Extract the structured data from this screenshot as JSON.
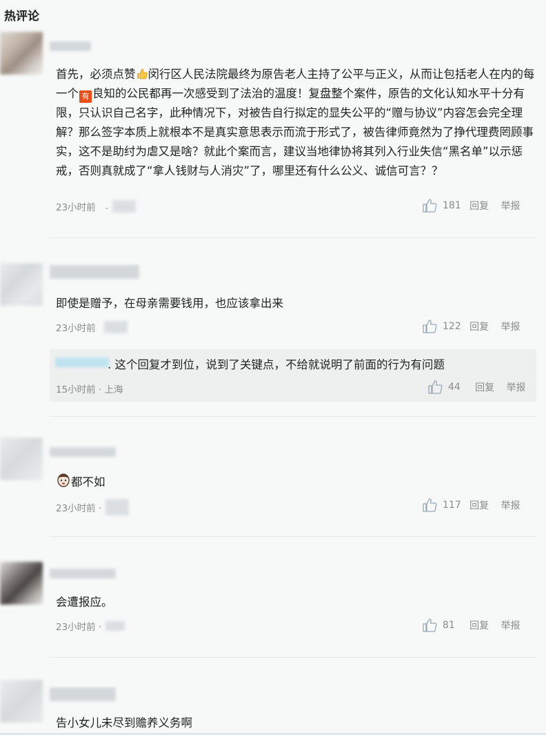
{
  "section_title": "热评论",
  "comments": [
    {
      "text_parts": [
        "首先，必须点赞",
        "闵行区人民法院最终为原告老人主持了公平与正义，从而让包括老人在内的每一个",
        "良知的公民都再一次感受到了法治的温度！复盘整个案件，原告的文化认知水平十分有限，只认识自己名字，此种情况下，对被告自行拟定的显失公平的“赠与协议”内容怎会完全理解？那么签字本质上就根本不是真实意思表示而流于形式了，被告律师竟然为了挣代理费罔顾事实，这不是助纣为虐又是啥？就此个案而言，建议当地律协将其列入行业失信“黑名单”以示惩戒，否则真就成了“拿人钱财与人消灾”了，哪里还有什么公义、诚信可言？？"
      ],
      "badge": "有",
      "time": "23小时前",
      "likes": "181",
      "reply_label": "回复",
      "report_label": "举报"
    },
    {
      "text": "即使是赠予，在母亲需要钱用，也应该拿出来",
      "time": "23小时前",
      "likes": "122",
      "reply_label": "回复",
      "report_label": "举报",
      "sub_reply": {
        "text": ". 这个回复才到位，说到了关键点，不给就说明了前面的行为有问题",
        "meta": "15小时前 · 上海",
        "likes": "44",
        "reply_label": "回复",
        "report_label": "举报"
      }
    },
    {
      "text": "都不如",
      "time": "23小时前 ·",
      "likes": "117",
      "reply_label": "回复",
      "report_label": "举报"
    },
    {
      "text": "会遭报应。",
      "time": "23小时前 ·",
      "likes": "81",
      "reply_label": "回复",
      "report_label": "举报"
    },
    {
      "text": "告小女儿未尽到赡养义务啊"
    }
  ],
  "colors": {
    "text": "#222222",
    "meta": "#8a8a8a",
    "background": "#f7f9f9",
    "subreply_bg": "#eef0f0",
    "badge": "#e8501a"
  }
}
